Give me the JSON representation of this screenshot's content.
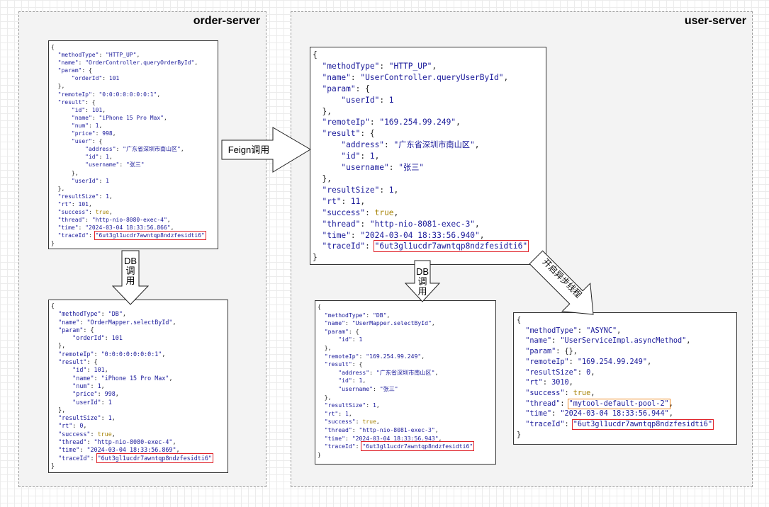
{
  "servers": {
    "order": {
      "title": "order-server"
    },
    "user": {
      "title": "user-server"
    }
  },
  "arrows": {
    "feign": "Feign调用",
    "db_order": [
      "DB",
      "调",
      "用"
    ],
    "db_user": [
      "DB",
      "调",
      "用"
    ],
    "async": "开启异步线程"
  },
  "boxes": {
    "order_http": [
      "{",
      "  \"methodType\": \"HTTP_UP\",",
      "  \"name\": \"OrderController.queryOrderById\",",
      "  \"param\": {",
      "      \"orderId\": 101",
      "  },",
      "  \"remoteIp\": \"0:0:0:0:0:0:0:1\",",
      "  \"result\": {",
      "      \"id\": 101,",
      "      \"name\": \"iPhone 15 Pro Max\",",
      "      \"num\": 1,",
      "      \"price\": 998,",
      "      \"user\": {",
      "          \"address\": \"广东省深圳市南山区\",",
      "          \"id\": 1,",
      "          \"username\": \"张三\"",
      "      },",
      "      \"userId\": 1",
      "  },",
      "  \"resultSize\": 1,",
      "  \"rt\": 101,",
      "  \"success\": true,",
      "  \"thread\": \"http-nio-8080-exec-4\",",
      "  \"time\": \"2024-03-04 18:33:56.866\",",
      "  \"traceId\": \"6ut3gl1ucdr7awntqp8ndzfesidti6\"",
      "}"
    ],
    "order_db": [
      "{",
      "  \"methodType\": \"DB\",",
      "  \"name\": \"OrderMapper.selectById\",",
      "  \"param\": {",
      "      \"orderId\": 101",
      "  },",
      "  \"remoteIp\": \"0:0:0:0:0:0:0:1\",",
      "  \"result\": {",
      "      \"id\": 101,",
      "      \"name\": \"iPhone 15 Pro Max\",",
      "      \"num\": 1,",
      "      \"price\": 998,",
      "      \"userId\": 1",
      "  },",
      "  \"resultSize\": 1,",
      "  \"rt\": 0,",
      "  \"success\": true,",
      "  \"thread\": \"http-nio-8080-exec-4\",",
      "  \"time\": \"2024-03-04 18:33:56.869\",",
      "  \"traceId\": \"6ut3gl1ucdr7awntqp8ndzfesidti6\"",
      "}"
    ],
    "user_http": [
      "{",
      "  \"methodType\": \"HTTP_UP\",",
      "  \"name\": \"UserController.queryUserById\",",
      "  \"param\": {",
      "      \"userId\": 1",
      "  },",
      "  \"remoteIp\": \"169.254.99.249\",",
      "  \"result\": {",
      "      \"address\": \"广东省深圳市南山区\",",
      "      \"id\": 1,",
      "      \"username\": \"张三\"",
      "  },",
      "  \"resultSize\": 1,",
      "  \"rt\": 11,",
      "  \"success\": true,",
      "  \"thread\": \"http-nio-8081-exec-3\",",
      "  \"time\": \"2024-03-04 18:33:56.940\",",
      "  \"traceId\": \"6ut3gl1ucdr7awntqp8ndzfesidti6\"",
      "}"
    ],
    "user_db": [
      "{",
      "  \"methodType\": \"DB\",",
      "  \"name\": \"UserMapper.selectById\",",
      "  \"param\": {",
      "      \"id\": 1",
      "  },",
      "  \"remoteIp\": \"169.254.99.249\",",
      "  \"result\": {",
      "      \"address\": \"广东省深圳市南山区\",",
      "      \"id\": 1,",
      "      \"username\": \"张三\"",
      "  },",
      "  \"resultSize\": 1,",
      "  \"rt\": 1,",
      "  \"success\": true,",
      "  \"thread\": \"http-nio-8081-exec-3\",",
      "  \"time\": \"2024-03-04 18:33:56.943\",",
      "  \"traceId\": \"6ut3gl1ucdr7awntqp8ndzfesidti6\"",
      "}"
    ],
    "user_async": [
      "{",
      "  \"methodType\": \"ASYNC\",",
      "  \"name\": \"UserServiceImpl.asyncMethod\",",
      "  \"param\": {},",
      "  \"remoteIp\": \"169.254.99.249\",",
      "  \"resultSize\": 0,",
      "  \"rt\": 3010,",
      "  \"success\": true,",
      "  \"thread\": \"mytool-default-pool-2\",",
      "  \"time\": \"2024-03-04 18:33:56.944\",",
      "  \"traceId\": \"6ut3gl1ucdr7awntqp8ndzfesidti6\"",
      "}"
    ]
  },
  "colors": {
    "highlight_trace": "#e0242b",
    "highlight_thread": "#f08a24"
  }
}
